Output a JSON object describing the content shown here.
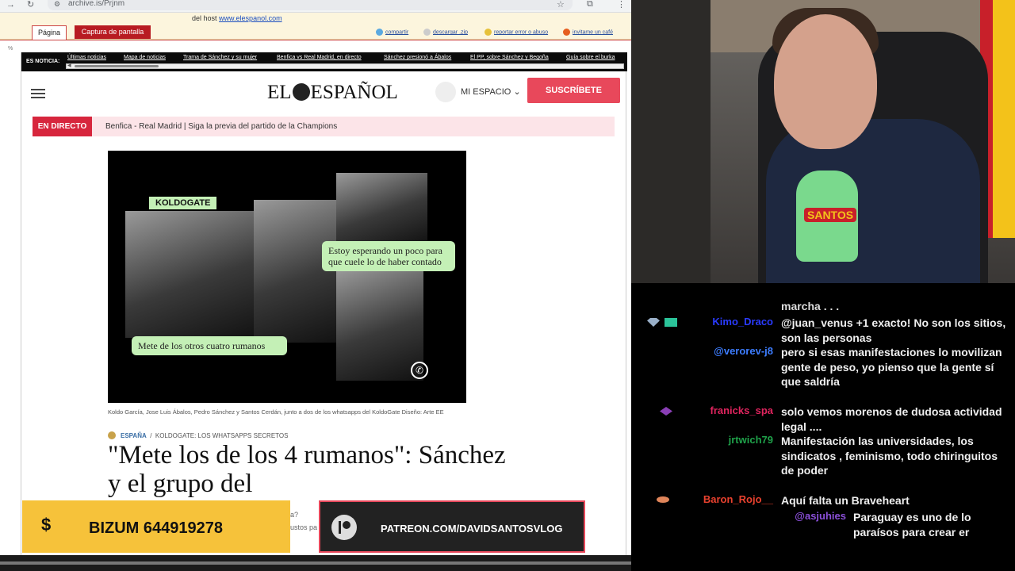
{
  "browser": {
    "url": "archive.is/Prjnm",
    "archive": {
      "host_label": "del host",
      "host_link": "www.elespanol.com",
      "tab_page": "Página",
      "tab_capture": "Captura de pantalla",
      "actions": [
        "compartir",
        "descargar .zip",
        "reportar error o abuso",
        "invitame un café"
      ]
    },
    "ticker": {
      "lead": "ES NOTICIA:",
      "items": [
        "Últimas noticias",
        "Mapa de noticias",
        "Trama de Sánchez y su mujer",
        "Benfica vs Real Madrid, en directo",
        "Sánchez presionó a Ábalos",
        "El PP, sobre Sánchez y Begoña",
        "Guía sobre el burka"
      ]
    },
    "site": {
      "logo_left": "EL",
      "logo_right": "ESPAÑOL",
      "mi_espacio": "MI ESPACIO",
      "subscribe": "SUSCRÍBETE",
      "live_label": "EN DIRECTO",
      "live_text": "Benfica - Real Madrid | Siga la previa del partido de la Champions"
    },
    "article": {
      "hero_tag": "KOLDOGATE",
      "bubble_top": "Estoy esperando un poco para que cuele lo de haber contado",
      "bubble_bottom": "Mete de los otros cuatro rumanos",
      "caption": "Koldo García, Jose Luis Ábalos, Pedro Sánchez y Santos Cerdán, junto a dos de los whatsapps del KoldoGate  Diseño: Arte EE",
      "section": "ESPAÑA",
      "subsection": "KOLDOGATE: LOS WHATSAPPS SECRETOS",
      "headline": "\"Mete los de los 4 rumanos\": Sánchez y el grupo del"
    },
    "behind_text": [
      "a?",
      "ustos pa"
    ]
  },
  "overlays": {
    "bizum_symbol": "$",
    "bizum": "BIZUM 644919278",
    "patreon": "PATREON.COM/DAVIDSANTOSVLOG"
  },
  "webcam": {
    "mic_logo": "SANTOS"
  },
  "chat": {
    "partial_top": "marcha . . .",
    "messages": [
      {
        "user": "Kimo_Draco",
        "color": "#2a3bff",
        "text": "@juan_venus +1 exacto! No son los sitios, son las personas"
      },
      {
        "user": "@verorev-j8",
        "color": "#3d7dff",
        "text": "pero si esas manifestaciones lo movilizan gente de peso, yo pienso que la gente sí que saldría"
      },
      {
        "user": "franicks_spa",
        "color": "#e0245e",
        "text": "solo vemos morenos de dudosa actividad legal ...."
      },
      {
        "user": "jrtwich79",
        "color": "#1fa24a",
        "text": "Manifestación las universidades, los sindicatos , feminismo, todo chiringuitos de poder"
      },
      {
        "user": "Baron_Rojo__",
        "color": "#e8412e",
        "text": "Aquí falta un Braveheart"
      },
      {
        "user": "@asjuhies",
        "color": "#8a4fd8",
        "text": "Paraguay es uno de lo paraísos para crear er"
      }
    ]
  }
}
